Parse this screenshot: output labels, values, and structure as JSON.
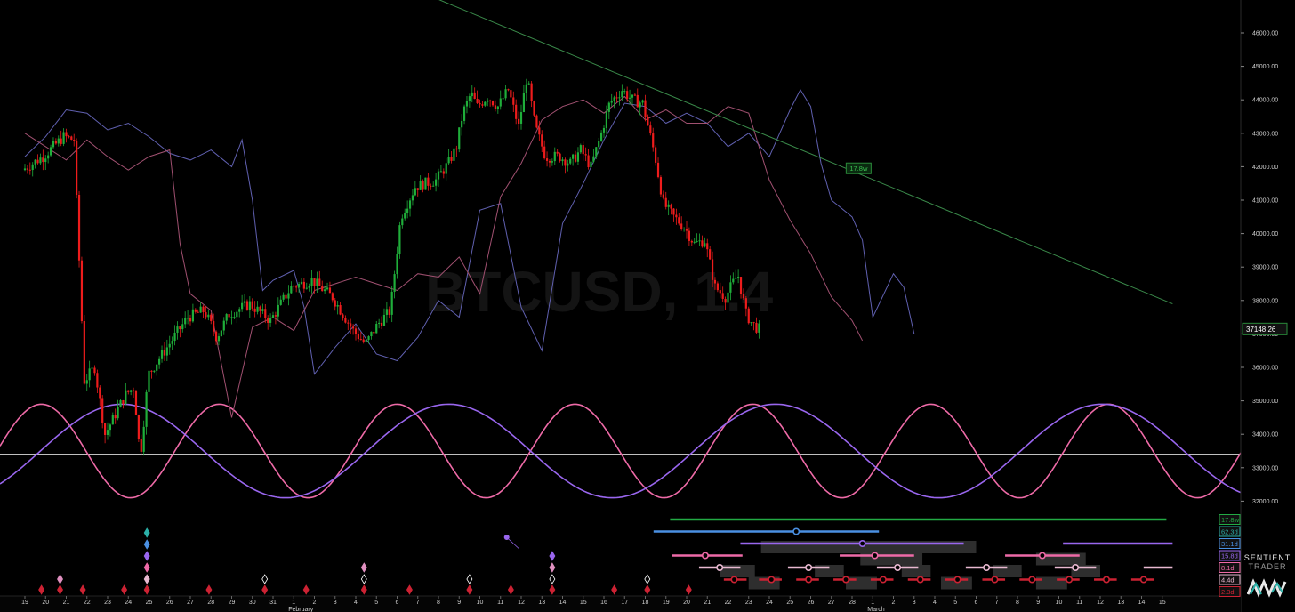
{
  "chart_data": {
    "type": "candlestick",
    "symbol_watermark": "BTCUSD, 1.4",
    "y_axis": {
      "ticks": [
        "46000.00",
        "45000.00",
        "44000.00",
        "43000.00",
        "42000.00",
        "41000.00",
        "40000.00",
        "39000.00",
        "38000.00",
        "37000.00",
        "36000.00",
        "35000.00",
        "34000.00",
        "33000.00",
        "32000.00"
      ],
      "range": [
        31500,
        46600
      ]
    },
    "current_price": "37148.26",
    "x_axis": {
      "day_labels": [
        "19",
        "20",
        "21",
        "22",
        "23",
        "24",
        "25",
        "26",
        "27",
        "28",
        "29",
        "30",
        "31",
        "1",
        "2",
        "3",
        "4",
        "5",
        "6",
        "7",
        "8",
        "9",
        "10",
        "11",
        "12",
        "13",
        "14",
        "15",
        "16",
        "17",
        "18",
        "19",
        "20",
        "21",
        "22",
        "23",
        "24",
        "25",
        "26",
        "27",
        "28",
        "1",
        "2",
        "3",
        "4",
        "5",
        "6",
        "7",
        "8",
        "9",
        "10",
        "11",
        "12",
        "13",
        "14",
        "15"
      ],
      "month_labels": [
        {
          "label": "February",
          "day_index": 13
        },
        {
          "label": "March",
          "day_index": 41
        }
      ]
    },
    "price_path": [
      [
        0,
        41900
      ],
      [
        1,
        42300
      ],
      [
        2,
        42900
      ],
      [
        2.5,
        42800
      ],
      [
        3,
        35600
      ],
      [
        3.5,
        36000
      ],
      [
        4,
        34000
      ],
      [
        4.5,
        34600
      ],
      [
        5,
        35200
      ],
      [
        5.4,
        35400
      ],
      [
        5.7,
        33300
      ],
      [
        6.1,
        35800
      ],
      [
        7,
        36600
      ],
      [
        8,
        37500
      ],
      [
        8.8,
        37700
      ],
      [
        9.4,
        36900
      ],
      [
        10,
        37600
      ],
      [
        11,
        37900
      ],
      [
        12,
        37400
      ],
      [
        13,
        38400
      ],
      [
        14,
        38600
      ],
      [
        15,
        38100
      ],
      [
        16,
        37100
      ],
      [
        16.6,
        36700
      ],
      [
        17.2,
        37300
      ],
      [
        17.8,
        37700
      ],
      [
        18.3,
        40500
      ],
      [
        19,
        41400
      ],
      [
        20,
        41600
      ],
      [
        20.6,
        42100
      ],
      [
        21,
        42600
      ],
      [
        21.3,
        43600
      ],
      [
        21.7,
        44200
      ],
      [
        22,
        43800
      ],
      [
        22.5,
        44100
      ],
      [
        23,
        43800
      ],
      [
        23.5,
        44300
      ],
      [
        24,
        43200
      ],
      [
        24.4,
        44700
      ],
      [
        24.8,
        43200
      ],
      [
        25.3,
        42300
      ],
      [
        26,
        42300
      ],
      [
        26.5,
        42100
      ],
      [
        27,
        42500
      ],
      [
        27.5,
        42000
      ],
      [
        28,
        43000
      ],
      [
        28.4,
        43900
      ],
      [
        29,
        44300
      ],
      [
        29.5,
        44000
      ],
      [
        30,
        43900
      ],
      [
        30.6,
        42300
      ],
      [
        31,
        40900
      ],
      [
        31.5,
        40500
      ],
      [
        32,
        40200
      ],
      [
        32.5,
        39700
      ],
      [
        33,
        39800
      ],
      [
        33.5,
        38400
      ],
      [
        34,
        38100
      ],
      [
        34.6,
        38800
      ],
      [
        35,
        37600
      ],
      [
        35.3,
        37300
      ],
      [
        35.6,
        37148
      ]
    ],
    "series": [
      {
        "name": "",
        "color": "#6060b0",
        "values": [
          [
            0,
            42300
          ],
          [
            1,
            42900
          ],
          [
            2,
            43700
          ],
          [
            3,
            43600
          ],
          [
            4,
            43100
          ],
          [
            5,
            43300
          ],
          [
            6,
            42900
          ],
          [
            7,
            42400
          ],
          [
            8,
            42200
          ],
          [
            9,
            42500
          ],
          [
            10,
            42000
          ],
          [
            10.5,
            42800
          ],
          [
            11,
            41000
          ],
          [
            11.5,
            38300
          ],
          [
            12,
            38600
          ],
          [
            13,
            38900
          ],
          [
            13.5,
            37800
          ],
          [
            14,
            35800
          ],
          [
            15,
            36600
          ],
          [
            16,
            37300
          ],
          [
            17,
            36400
          ],
          [
            18,
            36200
          ],
          [
            19,
            36900
          ],
          [
            20,
            38000
          ],
          [
            21,
            37500
          ],
          [
            22,
            40700
          ],
          [
            23,
            40900
          ],
          [
            24,
            37800
          ],
          [
            25,
            36500
          ],
          [
            26,
            40300
          ],
          [
            27,
            41500
          ],
          [
            28,
            42800
          ],
          [
            29,
            43900
          ],
          [
            30,
            43800
          ],
          [
            31,
            43300
          ],
          [
            32,
            43600
          ],
          [
            33,
            43300
          ],
          [
            34,
            42600
          ],
          [
            35,
            43000
          ],
          [
            36,
            42300
          ],
          [
            37,
            43700
          ],
          [
            37.5,
            44300
          ],
          [
            38,
            43800
          ],
          [
            38.5,
            42100
          ],
          [
            39,
            41000
          ],
          [
            40,
            40500
          ],
          [
            40.5,
            39800
          ],
          [
            41,
            37500
          ],
          [
            42,
            38800
          ],
          [
            42.5,
            38400
          ],
          [
            43,
            37000
          ]
        ]
      },
      {
        "name": "",
        "color": "#a05070",
        "values": [
          [
            0,
            43000
          ],
          [
            1,
            42600
          ],
          [
            2,
            42200
          ],
          [
            3,
            42800
          ],
          [
            4,
            42300
          ],
          [
            5,
            41900
          ],
          [
            6,
            42300
          ],
          [
            7,
            42500
          ],
          [
            7.5,
            39700
          ],
          [
            8,
            38200
          ],
          [
            9,
            37700
          ],
          [
            10,
            34500
          ],
          [
            11,
            37200
          ],
          [
            12,
            37500
          ],
          [
            13,
            37100
          ],
          [
            14,
            38300
          ],
          [
            15,
            38500
          ],
          [
            16,
            38700
          ],
          [
            17,
            38500
          ],
          [
            18,
            38300
          ],
          [
            19,
            38800
          ],
          [
            20,
            38700
          ],
          [
            21,
            39300
          ],
          [
            22,
            38200
          ],
          [
            23,
            41100
          ],
          [
            24,
            42100
          ],
          [
            25,
            43400
          ],
          [
            26,
            43800
          ],
          [
            27,
            44000
          ],
          [
            28,
            43600
          ],
          [
            29,
            44100
          ],
          [
            30,
            43400
          ],
          [
            31,
            43700
          ],
          [
            32,
            43300
          ],
          [
            33,
            43300
          ],
          [
            34,
            43800
          ],
          [
            35,
            43600
          ],
          [
            36,
            41600
          ],
          [
            37,
            40400
          ],
          [
            38,
            39400
          ],
          [
            39,
            38100
          ],
          [
            40,
            37400
          ],
          [
            40.5,
            36800
          ]
        ]
      },
      {
        "name": "",
        "color": "#ee6aa7",
        "wave": {
          "type": "cycle",
          "period_days": 8.6,
          "phase_day": 0.8
        }
      },
      {
        "name": "",
        "color": "#9966ee",
        "wave": {
          "type": "cycle",
          "period_days": 15.8,
          "phase_day": 4.7
        }
      }
    ],
    "trendline": {
      "color": "#3a8a4a",
      "from": [
        20.0,
        47000
      ],
      "to": [
        55.5,
        37900
      ],
      "label": "17.8w"
    },
    "horizontal_line": {
      "value": 33400,
      "color": "#ffffff"
    },
    "cycle_legend": [
      {
        "label": "17.8w",
        "color": "#22aa44"
      },
      {
        "label": "62.3d",
        "color": "#2bb0a8"
      },
      {
        "label": "31.1d",
        "color": "#4a90e2"
      },
      {
        "label": "15.8d",
        "color": "#9966ee"
      },
      {
        "label": "8.1d",
        "color": "#ee6aa7"
      },
      {
        "label": "4.4d",
        "color": "#e8b8d0"
      },
      {
        "label": "2.3d",
        "color": "#cc2233"
      }
    ],
    "cycle_bars": [
      {
        "row": 0,
        "color": "#22aa44",
        "from": 31.2,
        "to": 55.2,
        "marker": null
      },
      {
        "row": 1,
        "color": "#4a90e2",
        "from": 30.4,
        "to": 41.3,
        "marker": 37.3
      },
      {
        "row": 2,
        "color": "#9966ee",
        "from": 34.6,
        "to": 45.4,
        "marker": 40.5
      },
      {
        "row": 2,
        "color": "#9966ee",
        "from": 50.2,
        "to": 55.5,
        "marker": null
      },
      {
        "row": 3,
        "color": "#ee6aa7",
        "from": 31.3,
        "to": 34.7,
        "marker": 32.9
      },
      {
        "row": 3,
        "color": "#ee6aa7",
        "from": 39.4,
        "to": 43.0,
        "marker": 41.1
      },
      {
        "row": 3,
        "color": "#ee6aa7",
        "from": 47.4,
        "to": 51.0,
        "marker": 49.2
      },
      {
        "row": 4,
        "color": "#e8b8d0",
        "from": 32.6,
        "to": 34.6,
        "marker": 33.6
      },
      {
        "row": 4,
        "color": "#e8b8d0",
        "from": 36.9,
        "to": 38.9,
        "marker": 37.9
      },
      {
        "row": 4,
        "color": "#e8b8d0",
        "from": 41.2,
        "to": 43.2,
        "marker": 42.2
      },
      {
        "row": 4,
        "color": "#e8b8d0",
        "from": 45.5,
        "to": 47.5,
        "marker": 46.5
      },
      {
        "row": 4,
        "color": "#e8b8d0",
        "from": 49.8,
        "to": 51.8,
        "marker": 50.8
      },
      {
        "row": 4,
        "color": "#e8b8d0",
        "from": 54.1,
        "to": 55.5,
        "marker": null
      },
      {
        "row": 5,
        "color": "#cc2233",
        "from": 33.8,
        "to": 34.9,
        "marker": 34.3
      },
      {
        "row": 5,
        "color": "#cc2233",
        "from": 35.5,
        "to": 36.6,
        "marker": 36.1
      },
      {
        "row": 5,
        "color": "#cc2233",
        "from": 37.3,
        "to": 38.4,
        "marker": 37.9
      },
      {
        "row": 5,
        "color": "#cc2233",
        "from": 39.1,
        "to": 40.2,
        "marker": 39.7
      },
      {
        "row": 5,
        "color": "#cc2233",
        "from": 40.9,
        "to": 42.0,
        "marker": 41.5
      },
      {
        "row": 5,
        "color": "#cc2233",
        "from": 42.7,
        "to": 43.8,
        "marker": 43.3
      },
      {
        "row": 5,
        "color": "#cc2233",
        "from": 44.5,
        "to": 45.6,
        "marker": 45.1
      },
      {
        "row": 5,
        "color": "#cc2233",
        "from": 46.3,
        "to": 47.4,
        "marker": 46.9
      },
      {
        "row": 5,
        "color": "#cc2233",
        "from": 48.1,
        "to": 49.2,
        "marker": 48.7
      },
      {
        "row": 5,
        "color": "#cc2233",
        "from": 49.9,
        "to": 51.0,
        "marker": 50.5
      },
      {
        "row": 5,
        "color": "#cc2233",
        "from": 51.7,
        "to": 52.8,
        "marker": 52.3
      },
      {
        "row": 5,
        "color": "#cc2233",
        "from": 53.5,
        "to": 54.6,
        "marker": 54.1
      }
    ],
    "cycle_shadows": [
      {
        "row": 2,
        "from": 35.6,
        "to": 46.0
      },
      {
        "row": 3,
        "from": 40.4,
        "to": 43.4
      },
      {
        "row": 3,
        "from": 48.9,
        "to": 51.3
      },
      {
        "row": 4,
        "from": 33.6,
        "to": 35.3
      },
      {
        "row": 4,
        "from": 38.2,
        "to": 39.6
      },
      {
        "row": 4,
        "from": 42.4,
        "to": 43.8
      },
      {
        "row": 4,
        "from": 46.8,
        "to": 48.2
      },
      {
        "row": 4,
        "from": 50.6,
        "to": 52.0
      },
      {
        "row": 5,
        "from": 35.0,
        "to": 36.5
      },
      {
        "row": 5,
        "from": 39.7,
        "to": 41.2
      },
      {
        "row": 5,
        "from": 44.3,
        "to": 45.8
      },
      {
        "row": 5,
        "from": 48.9,
        "to": 50.4
      }
    ],
    "diamond_markers": [
      {
        "day": 1.7,
        "stack": [
          "#e090c0"
        ],
        "base": "#cc2233"
      },
      {
        "day": 0.8,
        "stack": [],
        "base": "#cc2233"
      },
      {
        "day": 2.8,
        "stack": [],
        "base": "#cc2233"
      },
      {
        "day": 4.8,
        "stack": [],
        "base": "#cc2233"
      },
      {
        "day": 5.9,
        "stack": [
          "#e8b8d0",
          "#ee6aa7",
          "#9966ee",
          "#4a90e2",
          "#2bb0a8"
        ],
        "base": "#cc2233"
      },
      {
        "day": 8.9,
        "stack": [],
        "base": "#cc2233"
      },
      {
        "day": 11.6,
        "stack": [
          "#ffffff"
        ],
        "base": "#cc2233"
      },
      {
        "day": 13.6,
        "stack": [],
        "base": "#cc2233"
      },
      {
        "day": 16.4,
        "stack": [
          "#ffffff",
          "#e090c0"
        ],
        "base": "#cc2233"
      },
      {
        "day": 18.6,
        "stack": [],
        "base": "#cc2233"
      },
      {
        "day": 21.5,
        "stack": [
          "#ffffff"
        ],
        "base": "#cc2233"
      },
      {
        "day": 23.5,
        "stack": [],
        "base": "#cc2233"
      },
      {
        "day": 25.5,
        "stack": [
          "#ffffff",
          "#e090c0",
          "#9966ee"
        ],
        "base": "#cc2233"
      },
      {
        "day": 28.5,
        "stack": [],
        "base": "#cc2233"
      },
      {
        "day": 30.1,
        "stack": [
          "#ffffff"
        ],
        "base": "#cc2233"
      },
      {
        "day": 32.1,
        "stack": [],
        "base": "#cc2233"
      }
    ]
  },
  "brand": {
    "line1": "SENTIENT",
    "line2": "TRADER"
  }
}
